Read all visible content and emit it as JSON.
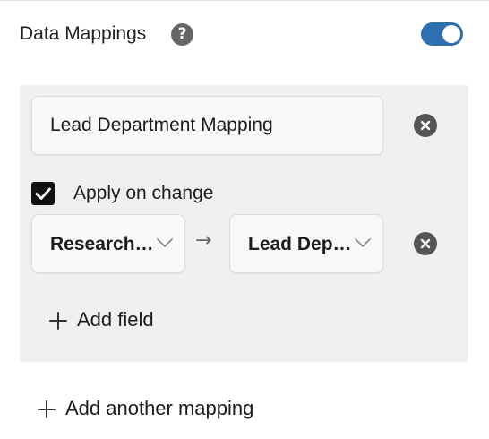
{
  "header": {
    "title": "Data Mappings",
    "help_icon": "question-circle-icon",
    "help_glyph": "?",
    "toggle": {
      "state": "on",
      "color": "#2e6fb0"
    }
  },
  "mapping": {
    "name_value": "Lead Department Mapping",
    "apply_on_change": {
      "label": "Apply on change",
      "checked": true
    },
    "rows": [
      {
        "source_value": "Research…",
        "arrow": "→",
        "target_value": "Lead Dep…"
      }
    ],
    "add_field_label": "Add field"
  },
  "footer": {
    "add_mapping_label": "Add another mapping"
  },
  "icons": {
    "remove": "close-circle-icon",
    "chevron": "chevron-down-icon",
    "add": "plus-icon",
    "check": "checkmark-icon"
  }
}
